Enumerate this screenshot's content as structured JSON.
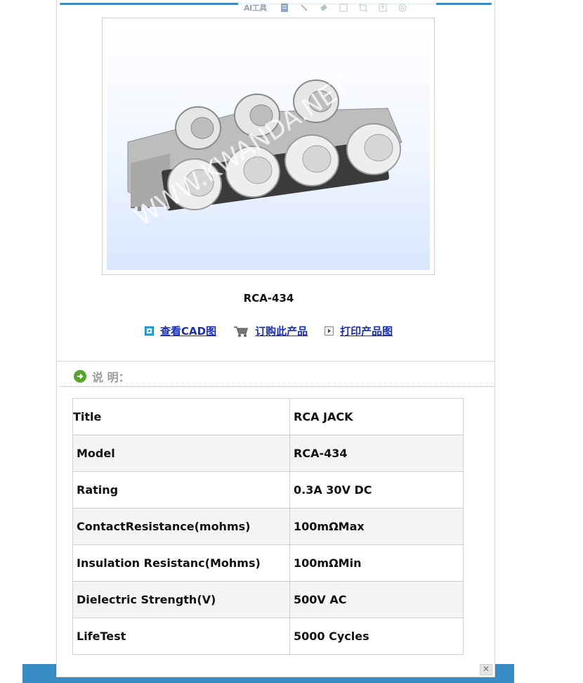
{
  "toolbar": {
    "ai_label": "AI工具"
  },
  "product": {
    "watermark": "WWW.KWANDA.NET",
    "name": "RCA-434"
  },
  "links": [
    {
      "label": "查看CAD图",
      "icon": "cad-icon"
    },
    {
      "label": "订购此产品",
      "icon": "cart-icon"
    },
    {
      "label": "打印产品图",
      "icon": "print-icon"
    }
  ],
  "description": {
    "heading": "说 明："
  },
  "specs": [
    {
      "key": "Title",
      "value": "RCA JACK"
    },
    {
      "key": "Model",
      "value": "RCA-434"
    },
    {
      "key": "Rating",
      "value": "0.3A 30V DC"
    },
    {
      "key": "ContactResistance(mohms)",
      "value": "100mΩMax"
    },
    {
      "key": "Insulation Resistanc(Mohms)",
      "value": "100mΩMin"
    },
    {
      "key": "Dielectric Strength(V)",
      "value": "500V AC"
    },
    {
      "key": "LifeTest",
      "value": "5000 Cycles"
    }
  ],
  "colors": {
    "accent": "#3a8cc4",
    "link": "#1a2fb0",
    "green": "#58a52c"
  }
}
